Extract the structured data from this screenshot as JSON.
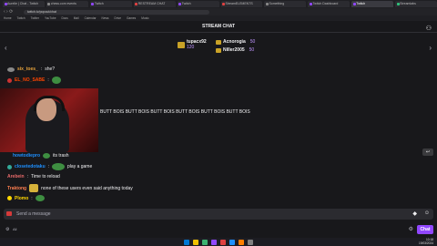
{
  "browser": {
    "tabs": [
      {
        "label": "Aurelie | Chat - Twitch",
        "color": "#9147ff",
        "active": false
      },
      {
        "label": "chess.com events",
        "color": "#888888",
        "active": false
      },
      {
        "label": "Twitch",
        "color": "#9147ff",
        "active": false
      },
      {
        "label": "RESTREAM CHAT",
        "color": "#e04040",
        "active": false
      },
      {
        "label": "Twitch",
        "color": "#9147ff",
        "active": false
      },
      {
        "label": "StreamELEMENTS",
        "color": "#e04040",
        "active": false
      },
      {
        "label": "Something",
        "color": "#888888",
        "active": false
      },
      {
        "label": "Twitch Dashboard",
        "color": "#9147ff",
        "active": false
      },
      {
        "label": "Twitch",
        "color": "#9147ff",
        "active": true
      },
      {
        "label": "Streamlabs",
        "color": "#30c07a",
        "active": false
      }
    ],
    "url": "twitch.tv/popout/chat",
    "bookmarks": [
      "Home",
      "Twitch",
      "Twitter",
      "YouTube",
      "Docs",
      "Mail",
      "Calendar",
      "News",
      "Drive",
      "Games",
      "Music"
    ]
  },
  "chat": {
    "header": "STREAM CHAT",
    "top_gifters": [
      {
        "name": "tupacx92",
        "count": "120"
      },
      {
        "name": "Acnorogia",
        "count": "50"
      },
      {
        "name": "Niller2005",
        "count": "50"
      }
    ],
    "messages": [
      {
        "user": "six_toes_",
        "text": "she?",
        "color": "#e6a23c"
      },
      {
        "user": "EL_NO_SABE",
        "text": "",
        "color": "#ff4500"
      },
      {
        "user": "",
        "text": "BUTT BOIS BUTT BOIS BUTT BOIS BUTT BOIS BUTT BOIS BUTT BOIS",
        "color": "#efeff1"
      },
      {
        "user": "howtodiepro",
        "text": "its trash",
        "color": "#1e90ff"
      },
      {
        "user": "closetedotaku",
        "text": "play a game",
        "color": "#1e90ff"
      },
      {
        "user": "Arebein",
        "text": "Time to reload",
        "color": "#e86a6a"
      },
      {
        "user": "Traktong",
        "text": "none of these users even said anything today",
        "color": "#ff7f50"
      },
      {
        "user": "Plomo",
        "text": "",
        "color": "#ffd700"
      }
    ],
    "input_placeholder": "Send a message",
    "chat_button": "Chat",
    "bits_label": "All"
  },
  "taskbar": {
    "time": "10:18",
    "date": "19/03/2024",
    "icon_colors": [
      "#0078d4",
      "#f0c000",
      "#3cb371",
      "#9147ff",
      "#e04040",
      "#1e90ff",
      "#ff7f00",
      "#808080"
    ]
  }
}
